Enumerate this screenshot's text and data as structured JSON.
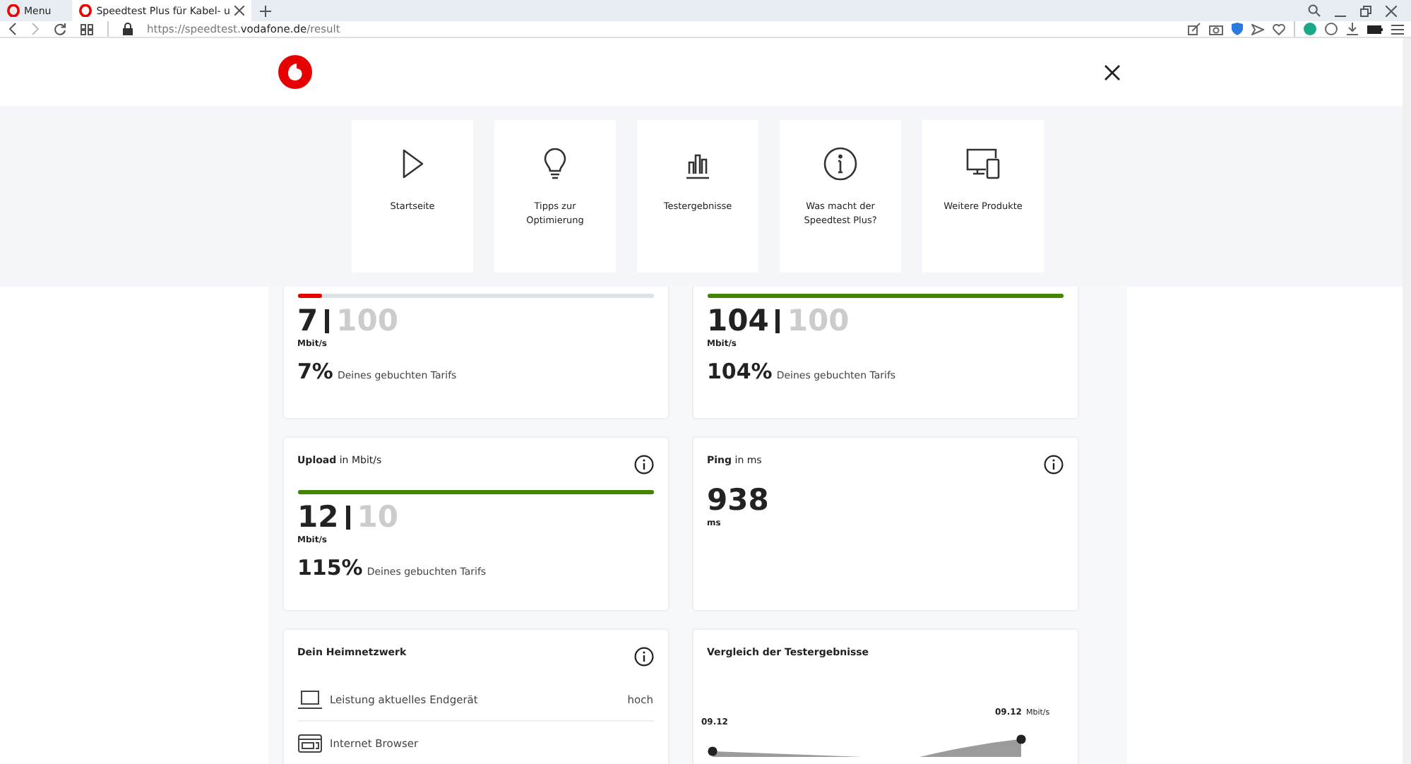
{
  "browser": {
    "tabs": [
      {
        "label": "Menu",
        "selected": false
      },
      {
        "label": "Speedtest Plus für Kabel- u",
        "selected": true
      }
    ],
    "url": {
      "host_prefix": "https://speedtest.",
      "host": "vodafone.de",
      "path": "/result"
    }
  },
  "nav": [
    {
      "label": "Startseite"
    },
    {
      "label": "Tipps zur Optimierung"
    },
    {
      "label": "Testergebnisse"
    },
    {
      "label": "Was macht der Speedtest Plus?"
    },
    {
      "label": "Weitere Produkte"
    }
  ],
  "results": [
    {
      "kind": "speed",
      "value": "7",
      "target": "100",
      "unit": "Mbit/s",
      "percent": "7%",
      "percent_text": "Deines gebuchten Tarifs",
      "level": 0.07,
      "color": "#e60000"
    },
    {
      "kind": "speed",
      "value": "104",
      "target": "100",
      "unit": "Mbit/s",
      "percent": "104%",
      "percent_text": "Deines gebuchten Tarifs",
      "level": 1,
      "color": "#428500"
    },
    {
      "kind": "speed",
      "title": "**Upload** in Mbit/s",
      "value": "12",
      "target": "10",
      "unit": "Mbit/s",
      "percent": "115%",
      "percent_text": "Deines gebuchten Tarifs",
      "level": 1,
      "color": "#428500"
    },
    {
      "kind": "ping",
      "title": "**Ping** in ms",
      "value": "938",
      "unit": "ms"
    }
  ],
  "home_network": {
    "title": "Dein Heimnetzwerk",
    "rows": [
      {
        "kind": "laptop",
        "label": "Leistung aktuelles Endgerät",
        "value": "hoch"
      },
      {
        "kind": "browser",
        "label": "Internet Browser"
      }
    ]
  },
  "comparison": {
    "title": "Vergleich der Testergebnisse",
    "point_labels": [
      "09.12",
      "09.12"
    ],
    "unit": "Mbit/s"
  }
}
